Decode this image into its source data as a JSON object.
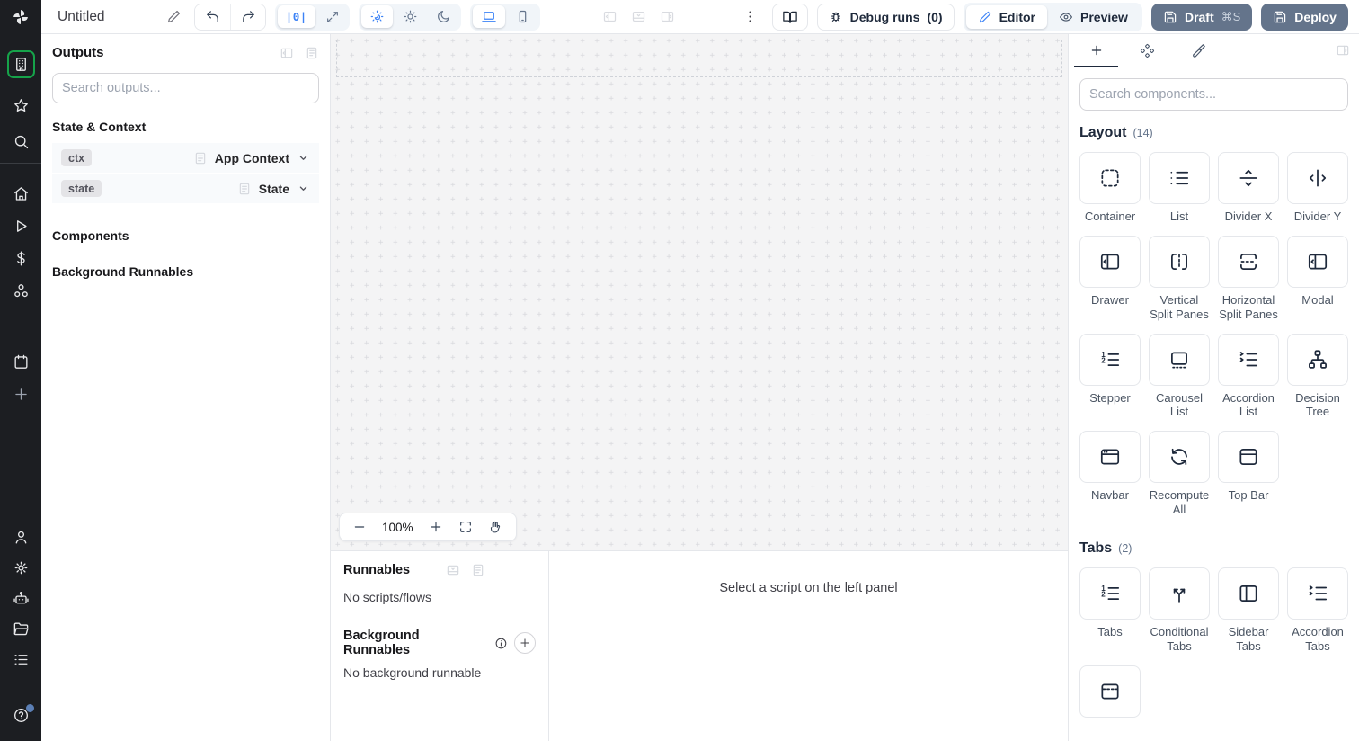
{
  "topbar": {
    "title": "Untitled",
    "zoom_reset_label": "|0|",
    "debug_runs": {
      "label": "Debug runs",
      "count": "(0)"
    },
    "editor_label": "Editor",
    "preview_label": "Preview",
    "draft": {
      "label": "Draft",
      "shortcut": "⌘S"
    },
    "deploy_label": "Deploy"
  },
  "sidebar": {
    "icons": [
      "windmill-logo",
      "apps",
      "favorites",
      "search",
      "home",
      "runs",
      "variables",
      "resources",
      "schedules",
      "add",
      "user",
      "settings",
      "workers",
      "folders",
      "logs",
      "help"
    ]
  },
  "outputs_panel": {
    "title": "Outputs",
    "search_placeholder": "Search outputs...",
    "state_context_title": "State & Context",
    "rows": [
      {
        "badge": "ctx",
        "type": "App Context"
      },
      {
        "badge": "state",
        "type": "State"
      }
    ],
    "components_title": "Components",
    "background_title": "Background Runnables"
  },
  "canvas": {
    "zoom_level": "100%"
  },
  "runnables": {
    "title": "Runnables",
    "empty_scripts": "No scripts/flows",
    "background_title": "Background Runnables",
    "empty_background": "No background runnable",
    "select_message": "Select a script on the left panel"
  },
  "components_panel": {
    "search_placeholder": "Search components...",
    "sections": [
      {
        "title": "Layout",
        "count": "(14)",
        "items": [
          {
            "label": "Container",
            "icon": "container-icon"
          },
          {
            "label": "List",
            "icon": "list-icon"
          },
          {
            "label": "Divider X",
            "icon": "divider-x-icon"
          },
          {
            "label": "Divider Y",
            "icon": "divider-y-icon"
          },
          {
            "label": "Drawer",
            "icon": "drawer-icon"
          },
          {
            "label": "Vertical Split Panes",
            "icon": "vertical-split-icon"
          },
          {
            "label": "Horizontal Split Panes",
            "icon": "horizontal-split-icon"
          },
          {
            "label": "Modal",
            "icon": "modal-icon"
          },
          {
            "label": "Stepper",
            "icon": "stepper-icon"
          },
          {
            "label": "Carousel List",
            "icon": "carousel-icon"
          },
          {
            "label": "Accordion List",
            "icon": "accordion-list-icon"
          },
          {
            "label": "Decision Tree",
            "icon": "decision-tree-icon"
          },
          {
            "label": "Navbar",
            "icon": "navbar-icon"
          },
          {
            "label": "Recompute All",
            "icon": "recompute-icon"
          },
          {
            "label": "Top Bar",
            "icon": "top-bar-icon"
          }
        ]
      },
      {
        "title": "Tabs",
        "count": "(2)",
        "items": [
          {
            "label": "Tabs",
            "icon": "tabs-icon"
          },
          {
            "label": "Conditional Tabs",
            "icon": "conditional-tabs-icon"
          },
          {
            "label": "Sidebar Tabs",
            "icon": "sidebar-tabs-icon"
          },
          {
            "label": "Accordion Tabs",
            "icon": "accordion-tabs-icon"
          },
          {
            "label": "",
            "icon": "dashed-top-bar-icon"
          }
        ]
      }
    ]
  },
  "colors": {
    "accent": "#3b82f6",
    "selected_green": "#16a34a",
    "action_button": "#64748b"
  }
}
